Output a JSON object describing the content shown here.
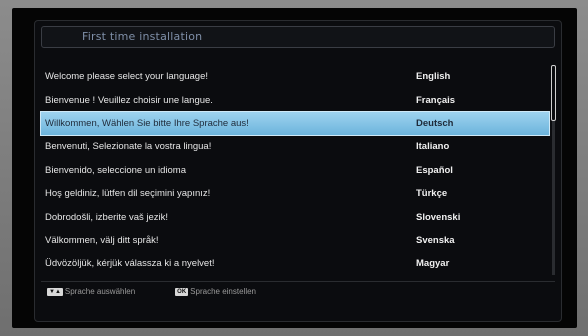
{
  "title": "First time installation",
  "languages": [
    {
      "message": "Welcome please select your language!",
      "language": "English"
    },
    {
      "message": "Bienvenue ! Veuillez choisir une langue.",
      "language": "Français"
    },
    {
      "message": "Willkommen, Wählen Sie bitte Ihre Sprache aus!",
      "language": "Deutsch"
    },
    {
      "message": "Benvenuti, Selezionate la vostra lingua!",
      "language": "Italiano"
    },
    {
      "message": "Bienvenido, seleccione un idioma",
      "language": "Español"
    },
    {
      "message": "Hoş geldiniz, lütfen dil seçimini yapınız!",
      "language": "Türkçe"
    },
    {
      "message": "Dobrodošli, izberite vaš jezik!",
      "language": "Slovenski"
    },
    {
      "message": "Välkommen, välj ditt språk!",
      "language": "Svenska"
    },
    {
      "message": "Üdvözöljük, kérjük válassza ki a nyelvet!",
      "language": "Magyar"
    }
  ],
  "selected_index": 2,
  "footer": {
    "select_keys": "▼▲",
    "select_label": "Sprache auswählen",
    "ok_key": "OK",
    "ok_label": "Sprache einstellen"
  },
  "colors": {
    "highlight": "#8fcbe9",
    "title_text": "#7f8fa8",
    "background": "#050505"
  },
  "icons": {
    "nav_keys": "arrow-down-up-icon",
    "ok_key": "ok-button-icon"
  }
}
